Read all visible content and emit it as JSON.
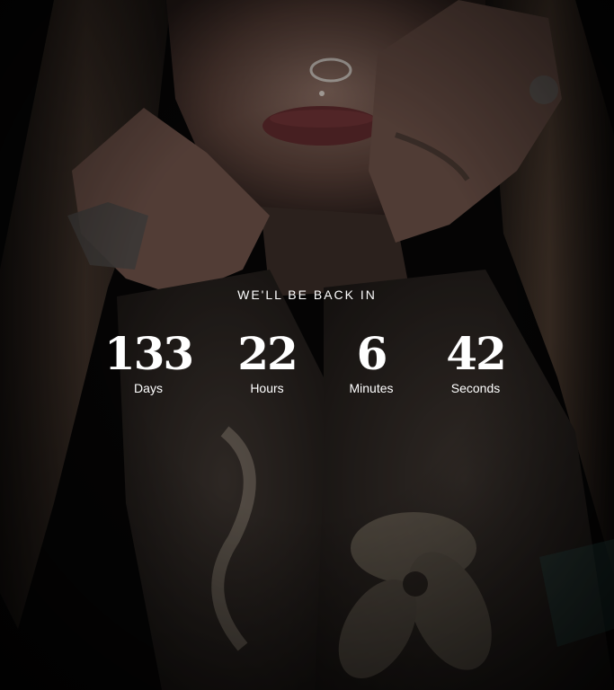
{
  "heading": "WE'LL BE BACK IN",
  "countdown": {
    "days": {
      "value": "133",
      "label": "Days"
    },
    "hours": {
      "value": "22",
      "label": "Hours"
    },
    "minutes": {
      "value": "6",
      "label": "Minutes"
    },
    "seconds": {
      "value": "42",
      "label": "Seconds"
    }
  },
  "colors": {
    "background": "#050505",
    "text": "#ffffff"
  }
}
